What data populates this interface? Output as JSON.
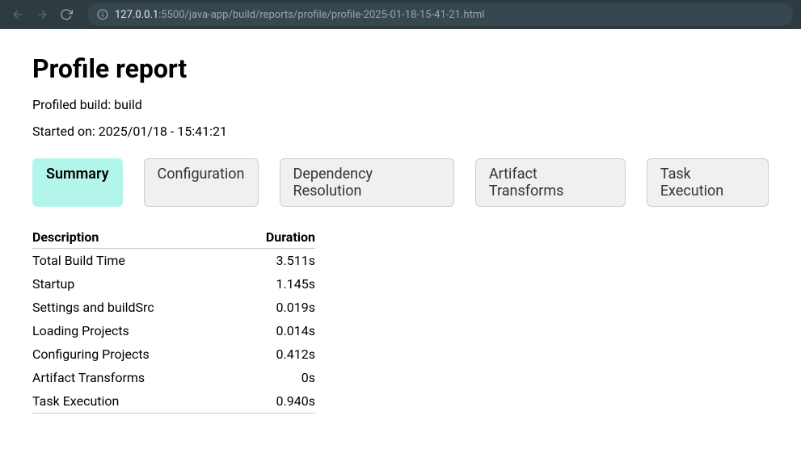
{
  "browser": {
    "url_host": "127.0.0.1",
    "url_rest": ":5500/java-app/build/reports/profile/profile-2025-01-18-15-41-21.html"
  },
  "page": {
    "title": "Profile report",
    "profiled_build": "Profiled build: build",
    "started_on": "Started on: 2025/01/18 - 15:41:21"
  },
  "tabs": [
    {
      "label": "Summary",
      "active": true
    },
    {
      "label": "Configuration",
      "active": false
    },
    {
      "label": "Dependency Resolution",
      "active": false
    },
    {
      "label": "Artifact Transforms",
      "active": false
    },
    {
      "label": "Task Execution",
      "active": false
    }
  ],
  "table": {
    "headers": [
      "Description",
      "Duration"
    ],
    "rows": [
      {
        "description": "Total Build Time",
        "duration": "3.511s"
      },
      {
        "description": "Startup",
        "duration": "1.145s"
      },
      {
        "description": "Settings and buildSrc",
        "duration": "0.019s"
      },
      {
        "description": "Loading Projects",
        "duration": "0.014s"
      },
      {
        "description": "Configuring Projects",
        "duration": "0.412s"
      },
      {
        "description": "Artifact Transforms",
        "duration": "0s"
      },
      {
        "description": "Task Execution",
        "duration": "0.940s"
      }
    ]
  }
}
